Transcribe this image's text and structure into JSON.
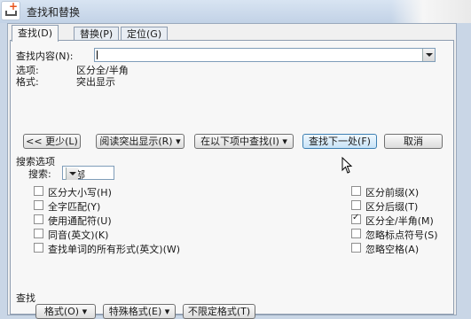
{
  "window": {
    "title": "查找和替换"
  },
  "tabs": [
    {
      "label": "查找(D)",
      "active": true
    },
    {
      "label": "替换(P)",
      "active": false
    },
    {
      "label": "定位(G)",
      "active": false
    }
  ],
  "find": {
    "label": "查找内容(N):",
    "value": "",
    "options_label": "选项:",
    "options_value": "区分全/半角",
    "format_label": "格式:",
    "format_value": "突出显示"
  },
  "buttons": {
    "less": "<< 更少(L)",
    "reading_highlight": "阅读突出显示(R) ▾",
    "find_in": "在以下项中查找(I) ▾",
    "find_next": "查找下一处(F)",
    "cancel": "取消"
  },
  "search_options": {
    "title": "搜索选项",
    "search_label": "搜索:",
    "search_value": "全部",
    "left": [
      {
        "label": "区分大小写(H)",
        "checked": false
      },
      {
        "label": "全字匹配(Y)",
        "checked": false
      },
      {
        "label": "使用通配符(U)",
        "checked": false
      },
      {
        "label": "同音(英文)(K)",
        "checked": false
      },
      {
        "label": "查找单词的所有形式(英文)(W)",
        "checked": false
      }
    ],
    "right": [
      {
        "label": "区分前缀(X)",
        "checked": false
      },
      {
        "label": "区分后缀(T)",
        "checked": false
      },
      {
        "label": "区分全/半角(M)",
        "checked": true
      },
      {
        "label": "忽略标点符号(S)",
        "checked": false
      },
      {
        "label": "忽略空格(A)",
        "checked": false
      }
    ]
  },
  "find_section": {
    "title": "查找",
    "format_btn": "格式(O) ▾",
    "special_btn": "特殊格式(E) ▾",
    "no_format_btn": "不限定格式(T)"
  },
  "colors": {
    "accent": "#3c7fb1",
    "titlebar": "#c2d2e6",
    "dialog_bg": "#f0f0f0"
  }
}
